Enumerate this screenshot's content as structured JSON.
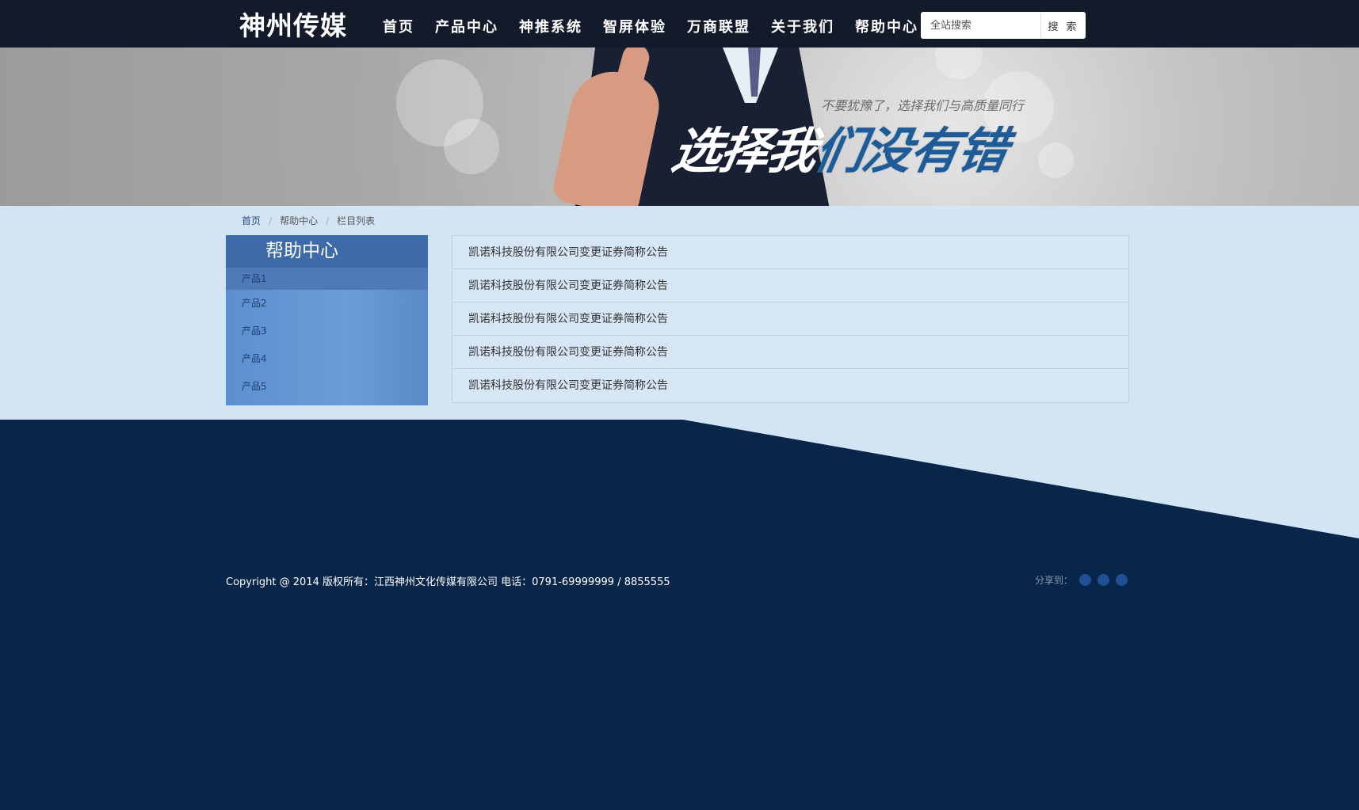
{
  "header": {
    "logo": "神州传媒",
    "nav": [
      "首页",
      "产品中心",
      "神推系统",
      "智屏体验",
      "万商联盟",
      "关于我们",
      "帮助中心"
    ],
    "search_placeholder": "全站搜索",
    "search_button": "搜 索"
  },
  "banner": {
    "subtitle": "不要犹豫了，选择我们与高质量同行",
    "headline_white": "选择我",
    "headline_blue": "们没有错"
  },
  "breadcrumb": {
    "home": "首页",
    "section": "帮助中心",
    "current": "栏目列表",
    "separator": "/"
  },
  "sidebar": {
    "title": "帮助中心",
    "items": [
      "产品1",
      "产品2",
      "产品3",
      "产品4",
      "产品5"
    ]
  },
  "list": {
    "items": [
      "凯诺科技股份有限公司变更证券简称公告",
      "凯诺科技股份有限公司变更证券简称公告",
      "凯诺科技股份有限公司变更证券简称公告",
      "凯诺科技股份有限公司变更证券简称公告",
      "凯诺科技股份有限公司变更证券简称公告"
    ]
  },
  "footer": {
    "copyright": "Copyright @ 2014 版权所有：江西神州文化传媒有限公司 电话：0791-69999999 / 8855555",
    "share_label": "分享到："
  },
  "colors": {
    "topbar": "#131b2b",
    "footer": "#08264a",
    "content_bg": "#d3e4f5",
    "sidebar_title": "#3d6ba8",
    "accent_blue": "#1d5c98"
  }
}
